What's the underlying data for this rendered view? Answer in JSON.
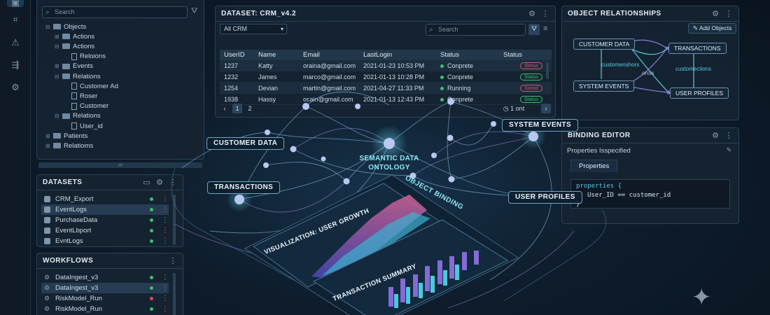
{
  "rail": {
    "icons": [
      "grid-icon",
      "chart-icon",
      "warning-icon",
      "flow-icon",
      "gear-icon"
    ]
  },
  "explorer": {
    "search_placeholder": "Search",
    "tree": [
      {
        "label": "Objects",
        "level": 0,
        "type": "folder",
        "toggle": "⊟"
      },
      {
        "label": "Actions",
        "level": 1,
        "type": "folder",
        "toggle": "⊞"
      },
      {
        "label": "Actions",
        "level": 1,
        "type": "folder",
        "toggle": "⊟"
      },
      {
        "label": "Reloions",
        "level": 2,
        "type": "file",
        "toggle": ""
      },
      {
        "label": "Events",
        "level": 1,
        "type": "folder",
        "toggle": "⊞"
      },
      {
        "label": "Relations",
        "level": 1,
        "type": "folder",
        "toggle": "⊟"
      },
      {
        "label": "Customer Ad",
        "level": 2,
        "type": "file",
        "toggle": ""
      },
      {
        "label": "Roser",
        "level": 2,
        "type": "file",
        "toggle": ""
      },
      {
        "label": "Customer",
        "level": 2,
        "type": "file",
        "toggle": ""
      },
      {
        "label": "Relations",
        "level": 1,
        "type": "folder",
        "toggle": "⊟"
      },
      {
        "label": "User_id",
        "level": 2,
        "type": "file",
        "toggle": ""
      },
      {
        "label": "Patients",
        "level": 0,
        "type": "folder",
        "toggle": "⊞"
      },
      {
        "label": "Relatioms",
        "level": 0,
        "type": "folder",
        "toggle": "⊞"
      }
    ]
  },
  "datasets": {
    "title": "DATASETS",
    "items": [
      {
        "label": "CRM_Export",
        "status": "#3fbf6f",
        "selected": false
      },
      {
        "label": "EventLogs",
        "status": "#3fbf6f",
        "selected": true
      },
      {
        "label": "PurchaseData",
        "status": "#3fbf6f",
        "selected": false
      },
      {
        "label": "EventLbport",
        "status": "#3fbf6f",
        "selected": false
      },
      {
        "label": "EvntLogs",
        "status": "#3fbf6f",
        "selected": false
      }
    ]
  },
  "workflows": {
    "title": "WORKFLOWS",
    "items": [
      {
        "label": "DataIngest_v3",
        "status": "#3fbf6f",
        "selected": false
      },
      {
        "label": "DataIngest_v3",
        "status": "#3fbf6f",
        "selected": true
      },
      {
        "label": "RiskModel_Run",
        "status": "#e0484f",
        "selected": false
      },
      {
        "label": "RiskModel_Run",
        "status": "#3fbf6f",
        "selected": false
      }
    ]
  },
  "dataset_panel": {
    "title": "DATASET: CRM_v4.2",
    "filter_value": "All CRM",
    "search_placeholder": "Search",
    "columns": [
      "UserID",
      "Name",
      "Email",
      "LastLogin",
      "Status",
      "Status"
    ],
    "rows": [
      {
        "id": "1237",
        "name": "Katty",
        "email": "oraina@gmail.com",
        "login": "2021-01-23 10:53 PM",
        "status": "Conprete",
        "status_color": "#3fbf6f",
        "badge": "Stetus",
        "badge_color": "#d85a66"
      },
      {
        "id": "1232",
        "name": "James",
        "email": "marco@gmail.com",
        "login": "2021-01-13 10:28 PM",
        "status": "Conprete",
        "status_color": "#3fbf6f",
        "badge": "Status",
        "badge_color": "#3fbf6f"
      },
      {
        "id": "1254",
        "name": "Devian",
        "email": "martin@gmail.com",
        "login": "2021-04-27 11:33 PM",
        "status": "Running",
        "status_color": "#3fbf6f",
        "badge": "Sorisd",
        "badge_color": "#d85a66"
      },
      {
        "id": "1938",
        "name": "Hassy",
        "email": "ocain@gmail.com",
        "login": "2021-01-13 12:43 PM",
        "status": "Conprete",
        "status_color": "#3fbf6f",
        "badge": "Status",
        "badge_color": "#3fbf6f"
      }
    ],
    "pagination": {
      "prev": "‹",
      "pages": [
        "1",
        "2"
      ],
      "info": "1 ont",
      "next": "›"
    }
  },
  "relationships": {
    "title": "OBJECT RELATIONSHIPS",
    "add_label": "Add Objects",
    "nodes": [
      "CUSTOMER DATA",
      "TRANSACTIONS",
      "SYSTEM EVENTS",
      "USER PROFILES"
    ],
    "edge_labels": [
      "customenshors",
      "orois",
      "customections"
    ]
  },
  "binding": {
    "title": "BINDING EDITOR",
    "subtitle": "Properties Isspecified",
    "tab": "Properties",
    "code": [
      "properties {",
      "User_ID == customer_id",
      "}"
    ]
  },
  "overlay": {
    "customer_data": "CUSTOMER DATA",
    "transactions": "TRANSACTIONS",
    "system_events": "SYSTEM EVENTS",
    "user_profiles": "USER PROFILES",
    "center": [
      "SEMANTIC DATA",
      "ONTOLOGY"
    ],
    "object_binding": "OBJECT BINDING",
    "vis_growth": "VISUALIZATION: USER GROWTH",
    "vis_summary": "TRANSACTION SUMMARY"
  }
}
